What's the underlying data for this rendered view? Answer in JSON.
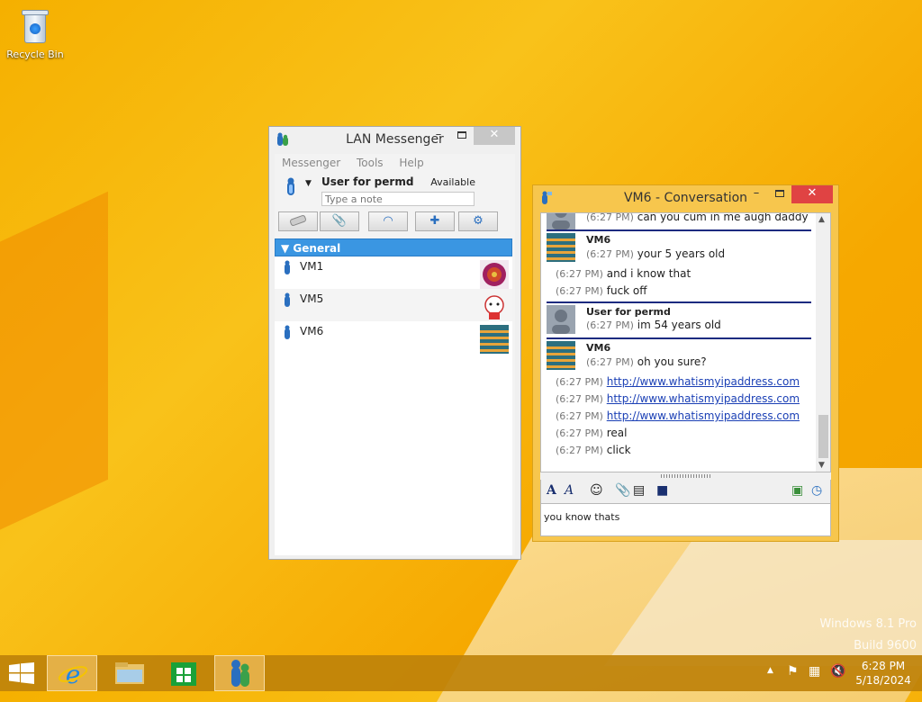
{
  "desktop": {
    "recycle_bin_label": "Recycle Bin"
  },
  "lan_window": {
    "title": "LAN Messenger",
    "menu": [
      "Messenger",
      "Tools",
      "Help"
    ],
    "user_name": "User for permd",
    "status": "Available",
    "note_placeholder": "Type a note",
    "group_name": "General",
    "contacts": [
      {
        "name": "VM1"
      },
      {
        "name": "VM5"
      },
      {
        "name": "VM6"
      }
    ]
  },
  "conversation": {
    "title": "VM6 - Conversation",
    "first_line_time": "(6:27 PM)",
    "first_line_text": "can you cum in me augh daddy",
    "blocks": [
      {
        "sender": "VM6",
        "lines": [
          {
            "time": "(6:27 PM)",
            "text": "your 5 years old"
          },
          {
            "time": "(6:27 PM)",
            "text": "and i know that"
          },
          {
            "time": "(6:27 PM)",
            "text": "fuck off"
          }
        ]
      },
      {
        "sender": "User for permd",
        "lines": [
          {
            "time": "(6:27 PM)",
            "text": "im 54 years old"
          }
        ]
      },
      {
        "sender": "VM6",
        "lines": [
          {
            "time": "(6:27 PM)",
            "text": "oh you sure?"
          },
          {
            "time": "(6:27 PM)",
            "text": "http://www.whatismyipaddress.com",
            "link": true
          },
          {
            "time": "(6:27 PM)",
            "text": "http://www.whatismyipaddress.com",
            "link": true
          },
          {
            "time": "(6:27 PM)",
            "text": "http://www.whatismyipaddress.com",
            "link": true
          },
          {
            "time": "(6:27 PM)",
            "text": "real"
          },
          {
            "time": "(6:27 PM)",
            "text": "click"
          }
        ]
      }
    ],
    "compose_value": "you know thats "
  },
  "watermark": {
    "line1": "Windows 8.1 Pro",
    "line2": "Build 9600"
  },
  "taskbar": {
    "time": "6:28 PM",
    "date": "5/18/2024"
  },
  "colors": {
    "accent": "#3a96e2",
    "close_red": "#e04343",
    "conv_frame": "#f7c64d",
    "separator": "#1c2a80"
  }
}
